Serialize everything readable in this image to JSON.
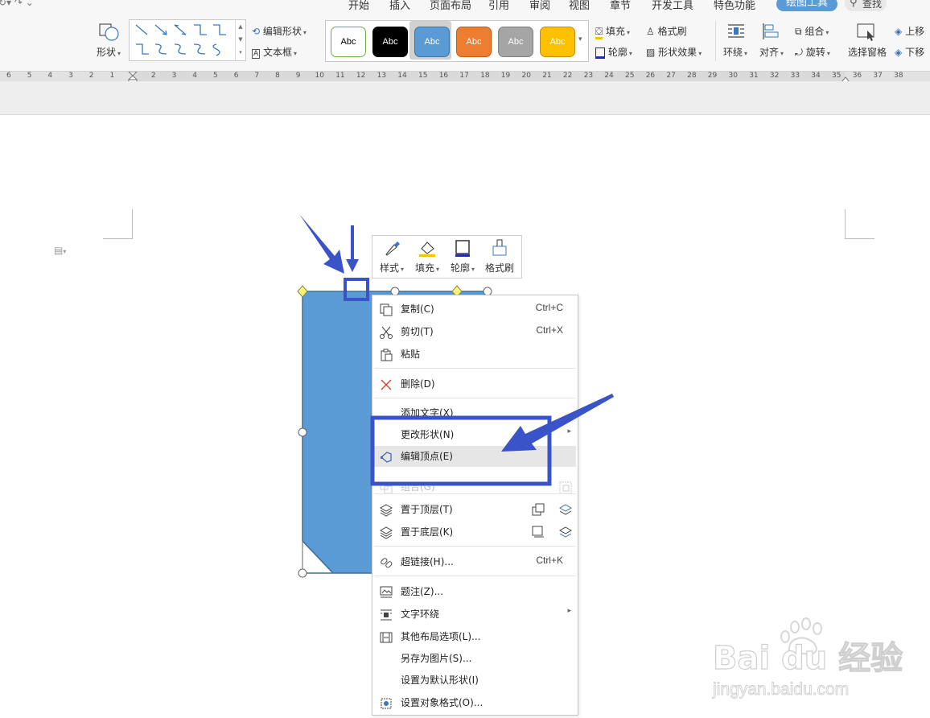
{
  "tabs": [
    "开始",
    "插入",
    "页面布局",
    "引用",
    "审阅",
    "视图",
    "章节",
    "开发工具",
    "特色功能",
    "绘图工具"
  ],
  "search_label": "查找",
  "ribbon": {
    "shape_label": "形状",
    "edit_shape": "编辑形状",
    "textbox": "文本框",
    "style_swatches": [
      {
        "label": "Abc",
        "bg": "#ffffff",
        "border": "#70ad47",
        "fg": "#000000"
      },
      {
        "label": "Abc",
        "bg": "#000000",
        "border": "#000000",
        "fg": "#ffffff"
      },
      {
        "label": "Abc",
        "bg": "#5b9bd5",
        "border": "#41719c",
        "fg": "#ffffff"
      },
      {
        "label": "Abc",
        "bg": "#ed7d31",
        "border": "#c55a11",
        "fg": "#ffffff"
      },
      {
        "label": "Abc",
        "bg": "#a5a5a5",
        "border": "#7f7f7f",
        "fg": "#ffffff"
      },
      {
        "label": "Abc",
        "bg": "#ffc000",
        "border": "#bf9000",
        "fg": "#ffffff"
      }
    ],
    "fill": "填充",
    "format_painter": "格式刷",
    "outline": "轮廓",
    "shape_effect": "形状效果",
    "wrap": "环绕",
    "align": "对齐",
    "group": "组合",
    "rotate": "旋转",
    "selection_pane": "选择窗格",
    "bring_forward": "上移",
    "send_backward": "下移"
  },
  "ruler_ticks": [
    "6",
    "5",
    "4",
    "3",
    "2",
    "1",
    "1",
    "2",
    "3",
    "4",
    "5",
    "6",
    "7",
    "8",
    "9",
    "10",
    "11",
    "12",
    "13",
    "14",
    "15",
    "16",
    "17",
    "18",
    "19",
    "20",
    "21",
    "22",
    "23",
    "24",
    "25",
    "26",
    "27",
    "28",
    "29",
    "30",
    "31",
    "32",
    "33",
    "34",
    "35",
    "36",
    "37",
    "38"
  ],
  "mini_toolbar": {
    "style": "样式",
    "fill": "填充",
    "outline": "轮廓",
    "painter": "格式刷"
  },
  "menu": {
    "copy": {
      "label": "复制(C)",
      "shortcut": "Ctrl+C"
    },
    "cut": {
      "label": "剪切(T)",
      "shortcut": "Ctrl+X"
    },
    "paste": {
      "label": "粘贴"
    },
    "delete": {
      "label": "删除(D)"
    },
    "add_text": {
      "label": "添加文字(X)"
    },
    "change_shape": {
      "label": "更改形状(N)"
    },
    "edit_points": {
      "label": "编辑顶点(E)"
    },
    "group": {
      "label": "组合(G)"
    },
    "bring_front": {
      "label": "置于顶层(T)"
    },
    "send_back": {
      "label": "置于底层(K)"
    },
    "hyperlink": {
      "label": "超链接(H)...",
      "shortcut": "Ctrl+K"
    },
    "caption": {
      "label": "题注(Z)..."
    },
    "text_wrap": {
      "label": "文字环绕"
    },
    "more_layout": {
      "label": "其他布局选项(L)..."
    },
    "save_as_picture": {
      "label": "另存为图片(S)..."
    },
    "set_default": {
      "label": "设置为默认形状(I)"
    },
    "format_object": {
      "label": "设置对象格式(O)..."
    }
  },
  "colors": {
    "shape_fill": "#5b9bd5",
    "annotation": "#3a53c8",
    "accent_tab": "#5b9bd5"
  },
  "watermark": {
    "logo": "Bai du 经验",
    "url": "jingyan.baidu.com"
  }
}
